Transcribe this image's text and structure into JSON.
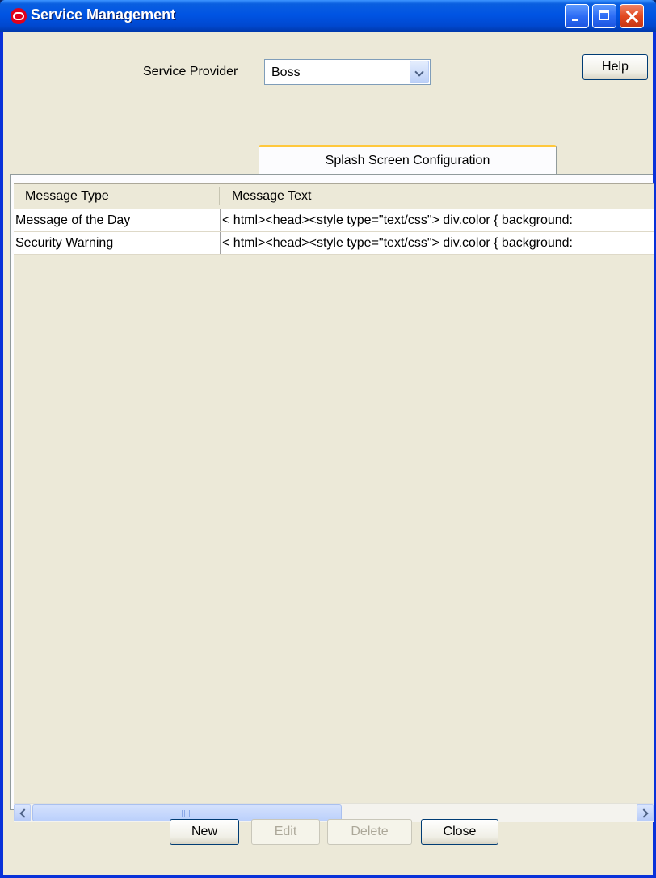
{
  "window": {
    "title": "Service Management",
    "controls": {
      "minimize": "minimize-icon",
      "maximize": "maximize-icon",
      "close": "close-icon"
    }
  },
  "header": {
    "service_provider_label": "Service Provider",
    "service_provider_value": "Boss",
    "help_label": "Help"
  },
  "tabs": [
    {
      "label": "Splash Screen Configuration",
      "selected": true
    }
  ],
  "table": {
    "columns": [
      "Message Type",
      "Message Text"
    ],
    "rows": [
      {
        "type": "Message of the Day",
        "text": "< html><head><style type=\"text/css\"> div.color { background:"
      },
      {
        "type": "Security Warning",
        "text": "< html><head><style type=\"text/css\"> div.color { background:"
      }
    ]
  },
  "buttons": {
    "new": "New",
    "edit": "Edit",
    "delete": "Delete",
    "close": "Close"
  },
  "colors": {
    "titlebar": "#0054e3",
    "window_bg": "#ece9d8",
    "tab_accent": "#ffc83c"
  }
}
